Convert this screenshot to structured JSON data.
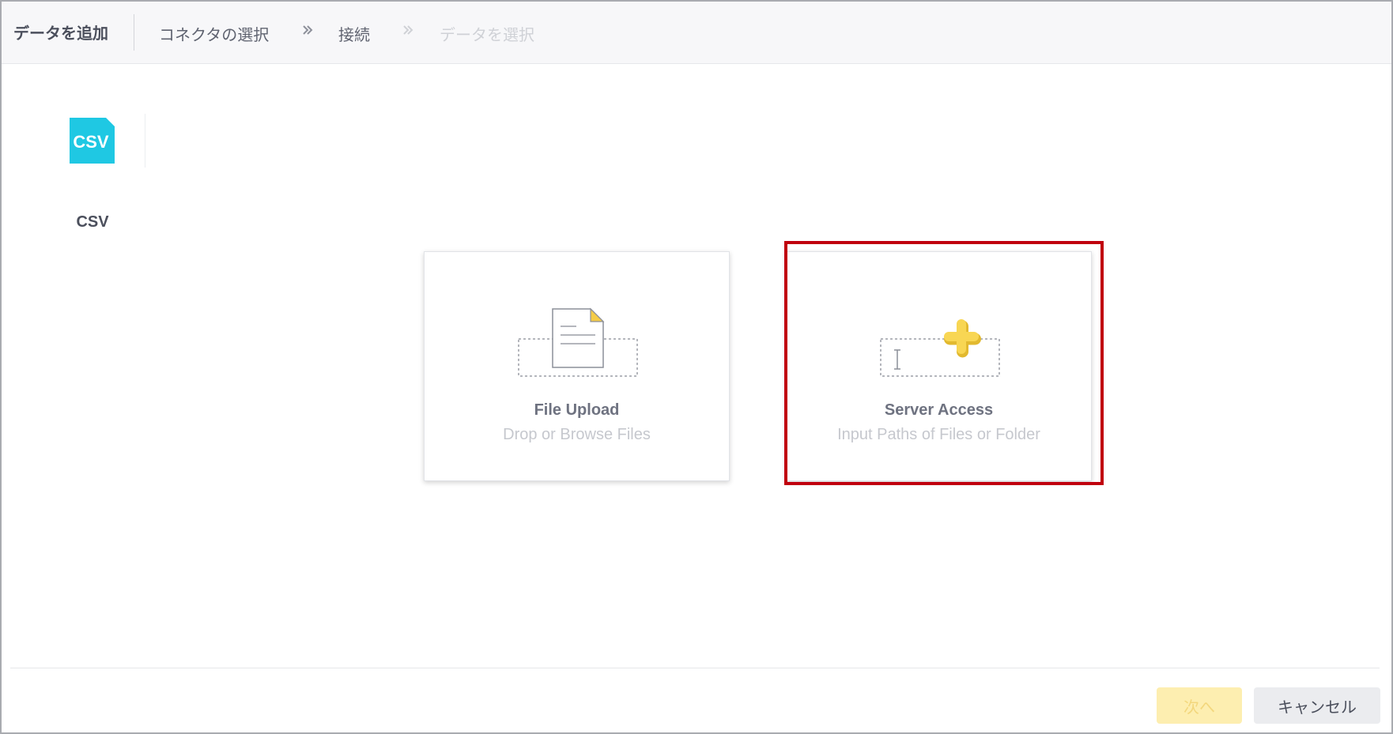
{
  "header": {
    "title": "データを追加",
    "breadcrumb": [
      "コネクタの選択",
      "接続",
      "データを選択"
    ]
  },
  "connector": {
    "icon_text": "CSV",
    "label": "CSV",
    "icon_color": "#1fc8e3"
  },
  "options": [
    {
      "title": "File Upload",
      "subtitle": "Drop or Browse Files",
      "icon": "file-upload-icon"
    },
    {
      "title": "Server Access",
      "subtitle": "Input Paths of Files or Folder",
      "icon": "server-access-icon",
      "highlighted": true
    }
  ],
  "highlight_color": "#c0000e",
  "footer": {
    "next_label": "次へ",
    "cancel_label": "キャンセル",
    "next_disabled": true
  }
}
